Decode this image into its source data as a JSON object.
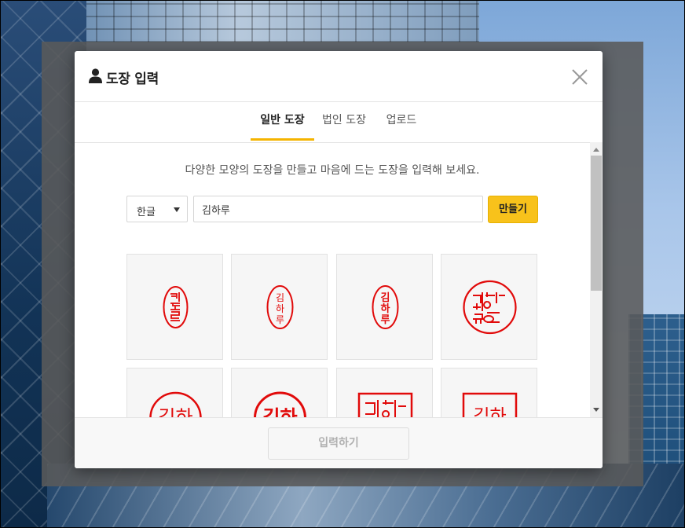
{
  "modal": {
    "title": "도장 입력",
    "tabs": [
      {
        "label": "일반 도장",
        "active": true
      },
      {
        "label": "법인 도장",
        "active": false
      },
      {
        "label": "업로드",
        "active": false
      }
    ],
    "instruction": "다양한 모양의 도장을 만들고 마음에 드는 도장을 입력해 보세요.",
    "language_select": {
      "selected": "한글"
    },
    "name_input": {
      "value": "김하루"
    },
    "make_button": "만들기",
    "submit_button": "입력하기",
    "stamps": [
      {
        "text": "김하루",
        "style": "oval-vertical-grid"
      },
      {
        "text": "김하루",
        "style": "oval-vertical"
      },
      {
        "text": "김하루",
        "style": "oval-vertical-bold"
      },
      {
        "text": "김하루",
        "style": "circle-grid"
      },
      {
        "text": "김하",
        "style": "circle"
      },
      {
        "text": "김하",
        "style": "circle-bold"
      },
      {
        "text": "김하",
        "style": "square-grid"
      },
      {
        "text": "김하",
        "style": "square"
      }
    ]
  },
  "colors": {
    "accent": "#f5b400",
    "stamp_red": "#e10a0a",
    "button_yellow": "#f8c21b"
  },
  "icons": [
    "user-icon",
    "close-icon",
    "chevron-down-icon"
  ]
}
